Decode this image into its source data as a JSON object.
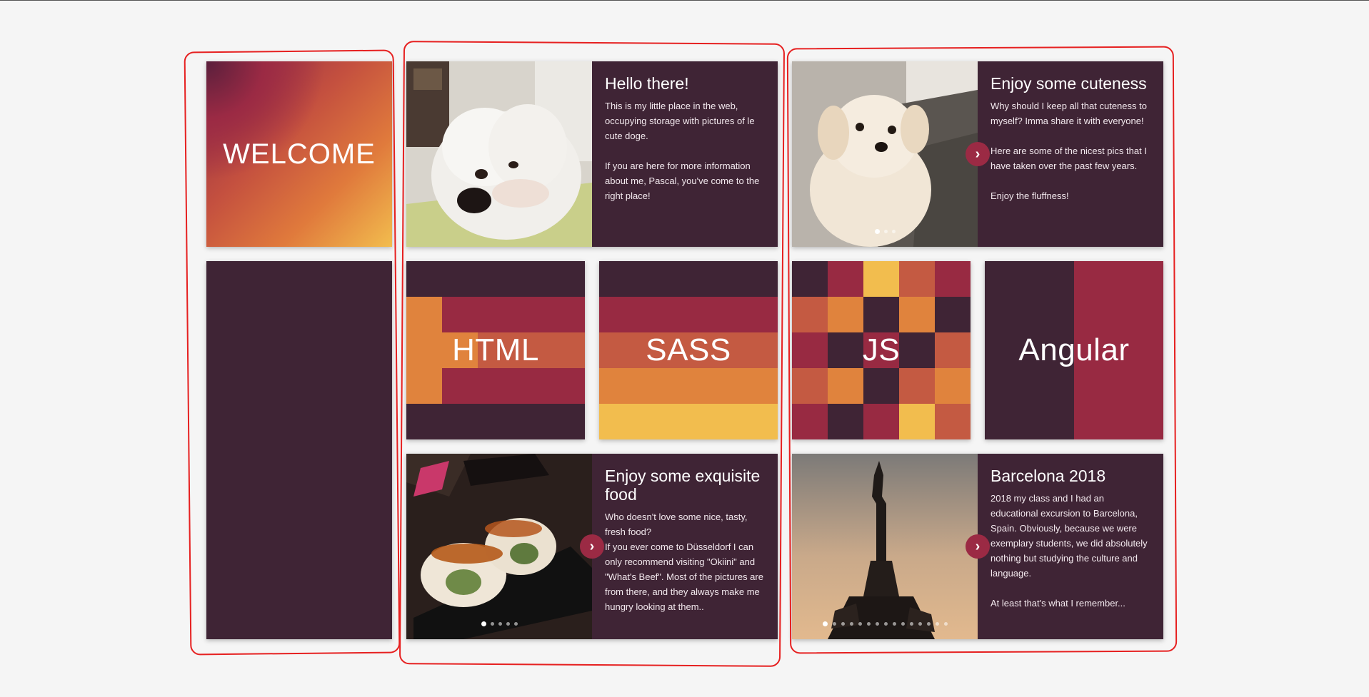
{
  "colors": {
    "dark": "#3f2435",
    "crimson": "#982a42",
    "rust": "#c45a42",
    "orange": "#e0833d",
    "yellow": "#f2bd4e",
    "annotation_red": "#e62020"
  },
  "welcome": {
    "label": "WELCOME"
  },
  "cards": {
    "hello": {
      "title": "Hello there!",
      "body": "This is my little place in the web, occupying storage with pictures of le cute doge.\n\nIf you are here for more information about me, Pascal, you've come to the right place!",
      "photo": "white-dog-lying-photo"
    },
    "cuteness": {
      "title": "Enjoy some cuteness",
      "body": "Why should I keep all that cuteness to myself? Imma share it with everyone!\n\nHere are some of the nicest pics that I have taken over the past few years.\n\nEnjoy the fluffness!",
      "photo": "white-dog-sitting-photo",
      "dots": 3,
      "active_dot": 0
    },
    "food": {
      "title": "Enjoy some exquisite food",
      "body": "Who doesn't love some nice, tasty, fresh food?\nIf you ever come to Düsseldorf I can only recommend visiting \"Okiini\" and \"What's Beef\". Most of the pictures are from there, and they always make me hungry looking at them..",
      "photo": "sushi-photo",
      "dots": 5,
      "active_dot": 0
    },
    "barcelona": {
      "title": "Barcelona 2018",
      "body": "2018 my class and I had an educational excursion to Barcelona, Spain. Obviously, because we were exemplary students, we did absolutely nothing but studying the culture and language.\n\nAt least that's what I remember...",
      "photo": "columbus-monument-photo",
      "dots": 15,
      "active_dot": 0
    }
  },
  "tech": {
    "html": "HTML",
    "sass": "SASS",
    "js": "JS",
    "angular": "Angular"
  },
  "icons": {
    "next": "chevron-right-icon"
  }
}
